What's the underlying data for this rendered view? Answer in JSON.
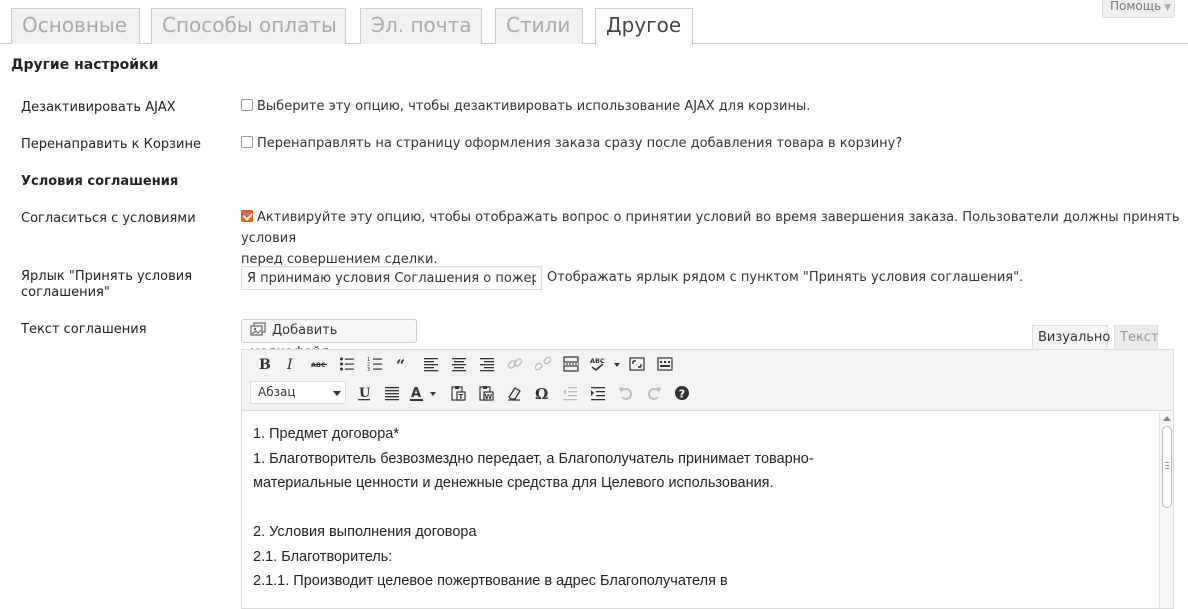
{
  "help": {
    "label": "Помощь",
    "caret": "▼"
  },
  "tabs": [
    "Основные",
    "Способы оплаты",
    "Эл. почта",
    "Стили",
    "Другое"
  ],
  "section_title": "Другие настройки",
  "rows": {
    "ajax": {
      "label": "Дезактивировать AJAX",
      "text": "Выберите эту опцию, чтобы дезактивировать использование AJAX для корзины.",
      "checked": false
    },
    "redirect": {
      "label": "Перенаправить к Корзине",
      "text": "Перенаправлять на страницу оформления заказа сразу после добавления товара в корзину?",
      "checked": false
    },
    "terms_heading": "Условия соглашения",
    "agree": {
      "label": "Согласиться с условиями",
      "text_line1": "Активируйте эту опцию, чтобы отображать вопрос о принятии условий во время завершения заказа. Пользователи должны принять условия",
      "text_line2": "перед совершением сделки.",
      "checked": true
    },
    "agree_label": {
      "label_line1": "Ярлык \"Принять условия",
      "label_line2": "соглашения\"",
      "value": "Я принимаю условия Соглашения о пожертвовании",
      "hint": "Отображать ярлык рядом с пунктом \"Принять условия соглашения\"."
    },
    "terms_text": {
      "label": "Текст соглашения"
    }
  },
  "editor": {
    "media_button": "Добавить медиафайл",
    "tab_visual": "Визуально",
    "tab_text": "Текст",
    "format_select": "Абзац",
    "content": [
      "1. Предмет договора*",
      "1. Благотворитель безвозмездно передает, а Благополучатель принимает товарно-",
      "материальные ценности и денежные средства для Целевого использования.",
      "",
      "2. Условия выполнения договора",
      "2.1. Благотворитель:",
      "2.1.1. Производит целевое пожертвование в адрес Благополучателя в"
    ]
  },
  "colors": {
    "checkbox_accent": "#e06a2c",
    "tab_border": "#cccccc"
  }
}
